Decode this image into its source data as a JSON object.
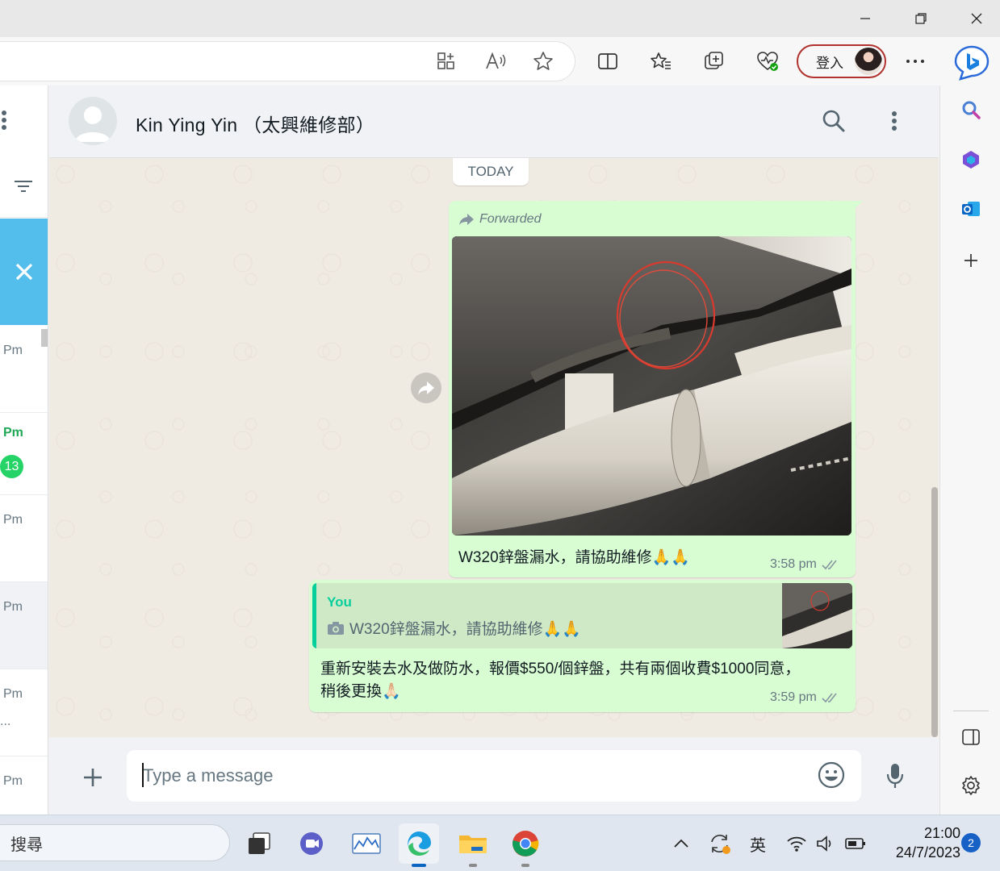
{
  "browser": {
    "signin_label": "登入",
    "window_controls": {
      "minimize": "–",
      "maximize": "❐",
      "close": "✕"
    }
  },
  "chat_list": {
    "rows": [
      {
        "time": "Pm",
        "unread": ""
      },
      {
        "time": "Pm",
        "unread": "13"
      },
      {
        "time": "Pm",
        "unread": ""
      },
      {
        "time": "Pm",
        "unread": ""
      },
      {
        "time": "Pm",
        "preview": "...",
        "unread": ""
      },
      {
        "time": "Pm",
        "unread": ""
      }
    ]
  },
  "chat": {
    "contact_name": "Kin Ying Yin （太興維修部）",
    "date_chip": "TODAY",
    "messages": [
      {
        "forwarded_label": "Forwarded",
        "text": "W320鋅盤漏水，請協助維修🙏🙏",
        "time": "3:58 pm"
      },
      {
        "quote_author": "You",
        "quote_text": "W320鋅盤漏水，請協助維修🙏🙏",
        "text_line1": "重新安裝去水及做防水，報價$550/個鋅盤，共有兩個收費$1000同意，",
        "text_line2": "稍後更換🙏🏻",
        "time": "3:59 pm"
      }
    ]
  },
  "composer": {
    "placeholder": "Type a message"
  },
  "taskbar": {
    "search_placeholder": "搜尋",
    "ime": "英",
    "time": "21:00",
    "date": "24/7/2023",
    "notifications": "2"
  },
  "colors": {
    "outgoing_bubble": "#d9fdd3",
    "chat_background": "#efeae2",
    "accent_green": "#06cf9c",
    "unread_badge": "#25d366",
    "close_block": "#53bdeb"
  }
}
